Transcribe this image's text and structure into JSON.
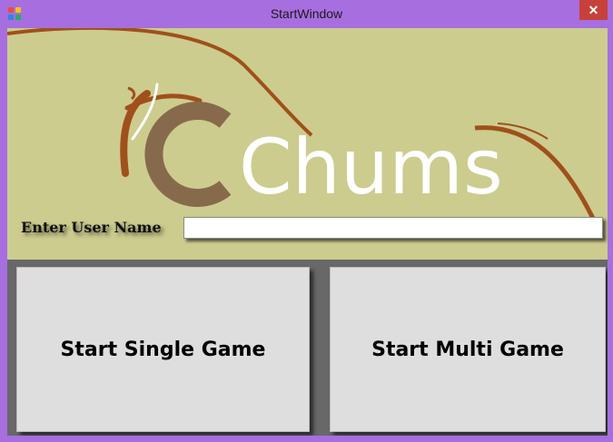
{
  "window": {
    "title": "StartWindow",
    "close_label": "✕"
  },
  "banner": {
    "logo_text": "Chums"
  },
  "user": {
    "label": "Enter User Name",
    "value": "",
    "placeholder": ""
  },
  "buttons": {
    "single": "Start Single Game",
    "multi": "Start Multi Game"
  },
  "colors": {
    "frame": "#a76ee0",
    "banner_bg": "#cccc8f",
    "swoosh": "#a0501a",
    "lower_bg": "#686868",
    "button_bg": "#dedede",
    "close_bg": "#c7413a"
  },
  "icons": {
    "app": "app-icon",
    "close": "close-icon"
  }
}
